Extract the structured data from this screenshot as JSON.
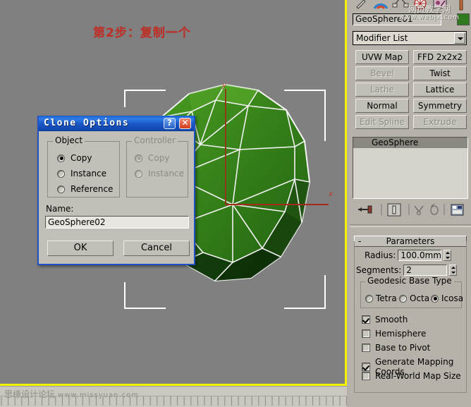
{
  "annotation": {
    "step_title": "第2步：复制一个",
    "color": "#c03028"
  },
  "watermarks": {
    "top": {
      "line1": "网页教学网",
      "line2": "www.webjx.com"
    },
    "bottom": {
      "site": "思缘设计论坛",
      "url": "www.missyuan.com"
    }
  },
  "viewport": {
    "label_x_axis": "x",
    "label_y_axis": "y",
    "background": "#808080",
    "active_border": "#f2f200",
    "object_color": "#2f7a1e",
    "wireframe_color": "#ffffff"
  },
  "dialog": {
    "title": "Clone Options",
    "help_button": "?",
    "close_button": "✕",
    "object_group": {
      "title": "Object",
      "options": [
        {
          "label": "Copy",
          "selected": true,
          "disabled": false
        },
        {
          "label": "Instance",
          "selected": false,
          "disabled": false
        },
        {
          "label": "Reference",
          "selected": false,
          "disabled": false
        }
      ]
    },
    "controller_group": {
      "title": "Controller",
      "options": [
        {
          "label": "Copy",
          "selected": true,
          "disabled": true
        },
        {
          "label": "Instance",
          "selected": false,
          "disabled": true
        }
      ]
    },
    "name_label": "Name:",
    "name_value": "GeoSphere02",
    "ok_label": "OK",
    "cancel_label": "Cancel"
  },
  "panel": {
    "object_name": "GeoSphere01",
    "object_color": "#2f7a1e",
    "modifier_list_label": "Modifier List",
    "modifier_buttons": [
      {
        "label": "UVW Map",
        "disabled": false
      },
      {
        "label": "FFD 2x2x2",
        "disabled": false
      },
      {
        "label": "Bevel",
        "disabled": true
      },
      {
        "label": "Twist",
        "disabled": false
      },
      {
        "label": "Lathe",
        "disabled": true
      },
      {
        "label": "Lattice",
        "disabled": false
      },
      {
        "label": "Normal",
        "disabled": false
      },
      {
        "label": "Symmetry",
        "disabled": false
      },
      {
        "label": "Edit Spline",
        "disabled": true
      },
      {
        "label": "Extrude",
        "disabled": true
      }
    ],
    "stack": [
      {
        "label": "GeoSphere",
        "selected": true
      }
    ],
    "stack_icons": [
      "pin-stack-icon",
      "show-end-result-icon",
      "make-unique-icon",
      "remove-modifier-icon",
      "configure-modifier-sets-icon"
    ],
    "rollout": {
      "title": "Parameters",
      "collapse_glyph": "-",
      "radius_label": "Radius:",
      "radius_value": "100.0mm",
      "segments_label": "Segments:",
      "segments_value": "2",
      "base_type": {
        "title": "Geodesic Base Type",
        "options": [
          {
            "label": "Tetra",
            "selected": false
          },
          {
            "label": "Octa",
            "selected": false
          },
          {
            "label": "Icosa",
            "selected": true
          }
        ]
      },
      "checkboxes": [
        {
          "label": "Smooth",
          "checked": true
        },
        {
          "label": "Hemisphere",
          "checked": false
        },
        {
          "label": "Base to Pivot",
          "checked": false
        },
        {
          "label": "Generate Mapping Coords.",
          "checked": true
        },
        {
          "label": "Real-World Map Size",
          "checked": false
        }
      ]
    }
  }
}
